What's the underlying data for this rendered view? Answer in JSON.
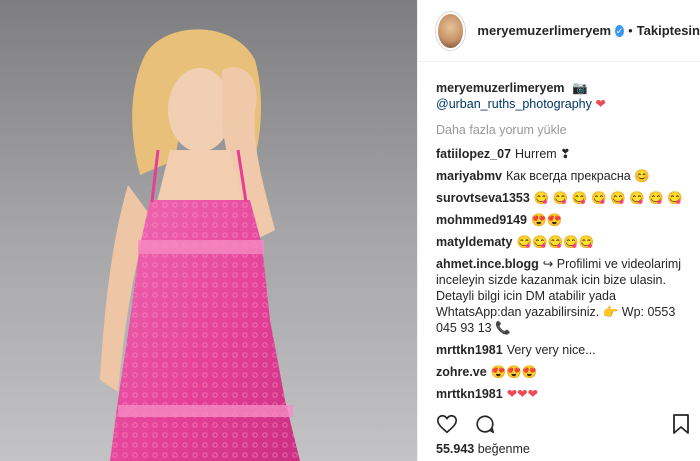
{
  "post": {
    "username": "meryemuzerlimeryem",
    "follow_label": "Takiptesin",
    "dot": "•",
    "verified_glyph": "✓"
  },
  "caption": {
    "username": "meryemuzerlimeryem",
    "camera": "📷",
    "mention": "@urban_ruths_photography",
    "heart": "❤"
  },
  "load_more_label": "Daha fazla yorum yükle",
  "comments": [
    {
      "user": "fatiilopez_07",
      "text": "Hurrem ❣"
    },
    {
      "user": "mariyabmv",
      "text": "Как всегда прекрасна 😊"
    },
    {
      "user": "surovtseva1353",
      "text": "😋 😋 😋 😋 😋 😋 😋 😋"
    },
    {
      "user": "mohmmed9149",
      "text": "😍😍"
    },
    {
      "user": "matyldematy",
      "text": "😋😋😋😋😋"
    },
    {
      "user": "ahmet.ince.blogg",
      "text": "↪ Profilimi ve videolarimj inceleyin sizde kazanmak icin bize ulasin. Detayli bilgi icin DM atabilir yada WhtatsApp:dan yazabilirsiniz. 👉 Wp: 0553 045 93 13 📞"
    },
    {
      "user": "mrttkn1981",
      "text": "Very very nice..."
    },
    {
      "user": "zohre.ve",
      "text": "😍😍😍"
    },
    {
      "user": "mrttkn1981",
      "text": "❤❤❤"
    }
  ],
  "likes": {
    "count": "55.943",
    "label": "beğenme"
  },
  "icons": [
    "heart-icon",
    "comment-icon",
    "bookmark-icon"
  ],
  "colors": {
    "accent": "#3897f0",
    "dress": "#e8479c",
    "link": "#003569"
  }
}
